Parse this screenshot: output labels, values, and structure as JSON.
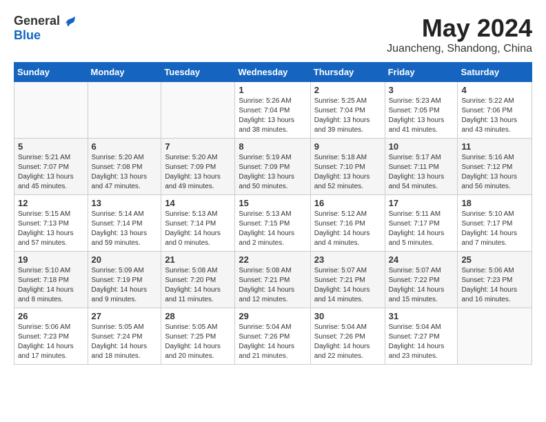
{
  "logo": {
    "general": "General",
    "blue": "Blue"
  },
  "title": "May 2024",
  "location": "Juancheng, Shandong, China",
  "days_header": [
    "Sunday",
    "Monday",
    "Tuesday",
    "Wednesday",
    "Thursday",
    "Friday",
    "Saturday"
  ],
  "weeks": [
    [
      {
        "day": "",
        "info": ""
      },
      {
        "day": "",
        "info": ""
      },
      {
        "day": "",
        "info": ""
      },
      {
        "day": "1",
        "info": "Sunrise: 5:26 AM\nSunset: 7:04 PM\nDaylight: 13 hours\nand 38 minutes."
      },
      {
        "day": "2",
        "info": "Sunrise: 5:25 AM\nSunset: 7:04 PM\nDaylight: 13 hours\nand 39 minutes."
      },
      {
        "day": "3",
        "info": "Sunrise: 5:23 AM\nSunset: 7:05 PM\nDaylight: 13 hours\nand 41 minutes."
      },
      {
        "day": "4",
        "info": "Sunrise: 5:22 AM\nSunset: 7:06 PM\nDaylight: 13 hours\nand 43 minutes."
      }
    ],
    [
      {
        "day": "5",
        "info": "Sunrise: 5:21 AM\nSunset: 7:07 PM\nDaylight: 13 hours\nand 45 minutes."
      },
      {
        "day": "6",
        "info": "Sunrise: 5:20 AM\nSunset: 7:08 PM\nDaylight: 13 hours\nand 47 minutes."
      },
      {
        "day": "7",
        "info": "Sunrise: 5:20 AM\nSunset: 7:09 PM\nDaylight: 13 hours\nand 49 minutes."
      },
      {
        "day": "8",
        "info": "Sunrise: 5:19 AM\nSunset: 7:09 PM\nDaylight: 13 hours\nand 50 minutes."
      },
      {
        "day": "9",
        "info": "Sunrise: 5:18 AM\nSunset: 7:10 PM\nDaylight: 13 hours\nand 52 minutes."
      },
      {
        "day": "10",
        "info": "Sunrise: 5:17 AM\nSunset: 7:11 PM\nDaylight: 13 hours\nand 54 minutes."
      },
      {
        "day": "11",
        "info": "Sunrise: 5:16 AM\nSunset: 7:12 PM\nDaylight: 13 hours\nand 56 minutes."
      }
    ],
    [
      {
        "day": "12",
        "info": "Sunrise: 5:15 AM\nSunset: 7:13 PM\nDaylight: 13 hours\nand 57 minutes."
      },
      {
        "day": "13",
        "info": "Sunrise: 5:14 AM\nSunset: 7:14 PM\nDaylight: 13 hours\nand 59 minutes."
      },
      {
        "day": "14",
        "info": "Sunrise: 5:13 AM\nSunset: 7:14 PM\nDaylight: 14 hours\nand 0 minutes."
      },
      {
        "day": "15",
        "info": "Sunrise: 5:13 AM\nSunset: 7:15 PM\nDaylight: 14 hours\nand 2 minutes."
      },
      {
        "day": "16",
        "info": "Sunrise: 5:12 AM\nSunset: 7:16 PM\nDaylight: 14 hours\nand 4 minutes."
      },
      {
        "day": "17",
        "info": "Sunrise: 5:11 AM\nSunset: 7:17 PM\nDaylight: 14 hours\nand 5 minutes."
      },
      {
        "day": "18",
        "info": "Sunrise: 5:10 AM\nSunset: 7:17 PM\nDaylight: 14 hours\nand 7 minutes."
      }
    ],
    [
      {
        "day": "19",
        "info": "Sunrise: 5:10 AM\nSunset: 7:18 PM\nDaylight: 14 hours\nand 8 minutes."
      },
      {
        "day": "20",
        "info": "Sunrise: 5:09 AM\nSunset: 7:19 PM\nDaylight: 14 hours\nand 9 minutes."
      },
      {
        "day": "21",
        "info": "Sunrise: 5:08 AM\nSunset: 7:20 PM\nDaylight: 14 hours\nand 11 minutes."
      },
      {
        "day": "22",
        "info": "Sunrise: 5:08 AM\nSunset: 7:21 PM\nDaylight: 14 hours\nand 12 minutes."
      },
      {
        "day": "23",
        "info": "Sunrise: 5:07 AM\nSunset: 7:21 PM\nDaylight: 14 hours\nand 14 minutes."
      },
      {
        "day": "24",
        "info": "Sunrise: 5:07 AM\nSunset: 7:22 PM\nDaylight: 14 hours\nand 15 minutes."
      },
      {
        "day": "25",
        "info": "Sunrise: 5:06 AM\nSunset: 7:23 PM\nDaylight: 14 hours\nand 16 minutes."
      }
    ],
    [
      {
        "day": "26",
        "info": "Sunrise: 5:06 AM\nSunset: 7:23 PM\nDaylight: 14 hours\nand 17 minutes."
      },
      {
        "day": "27",
        "info": "Sunrise: 5:05 AM\nSunset: 7:24 PM\nDaylight: 14 hours\nand 18 minutes."
      },
      {
        "day": "28",
        "info": "Sunrise: 5:05 AM\nSunset: 7:25 PM\nDaylight: 14 hours\nand 20 minutes."
      },
      {
        "day": "29",
        "info": "Sunrise: 5:04 AM\nSunset: 7:26 PM\nDaylight: 14 hours\nand 21 minutes."
      },
      {
        "day": "30",
        "info": "Sunrise: 5:04 AM\nSunset: 7:26 PM\nDaylight: 14 hours\nand 22 minutes."
      },
      {
        "day": "31",
        "info": "Sunrise: 5:04 AM\nSunset: 7:27 PM\nDaylight: 14 hours\nand 23 minutes."
      },
      {
        "day": "",
        "info": ""
      }
    ]
  ]
}
